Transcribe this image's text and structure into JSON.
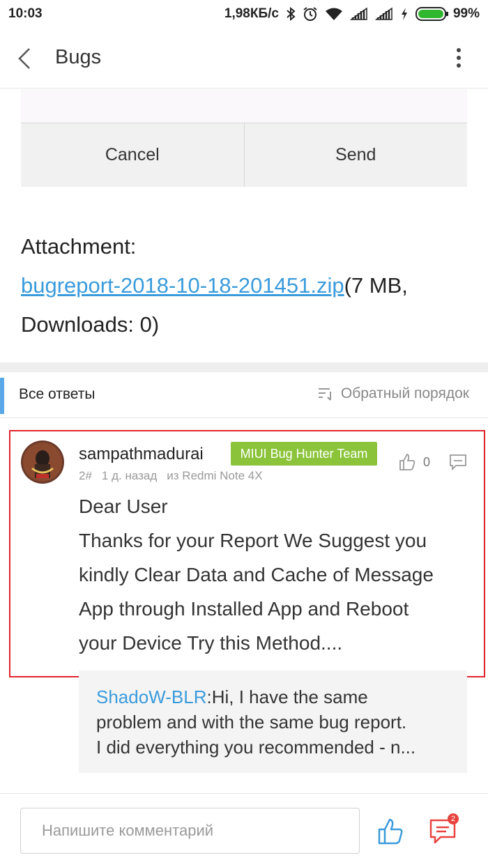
{
  "status_bar": {
    "time": "10:03",
    "speed": "1,98КБ/с",
    "battery": "99%"
  },
  "header": {
    "title": "Bugs"
  },
  "dialog": {
    "cancel_label": "Cancel",
    "send_label": "Send"
  },
  "attachment": {
    "label": "Attachment:",
    "file_link": "bugreport-2018-10-18-201451.zip",
    "size_info": "(7 MB,",
    "downloads": "Downloads: 0)"
  },
  "replies": {
    "title": "Все ответы",
    "order_label": "Обратный порядок"
  },
  "comment": {
    "username": "sampathmadurai",
    "badge": "MIUI Bug Hunter Team",
    "floor": "2#",
    "time": "1 д. назад",
    "device": "из Redmi Note 4X",
    "likes": "0",
    "body_lines": [
      "Dear User",
      "Thanks for your Report We Suggest you",
      "kindly Clear Data and Cache of Message",
      "App through Installed App and Reboot",
      "your Device Try this Method...."
    ]
  },
  "quote": {
    "author": "ShadoW-BLR",
    "lines": [
      ":Hi, I have the same",
      "problem and with the same bug report.",
      "I did everything you recommended - n..."
    ]
  },
  "bottom_bar": {
    "placeholder": "Напишите комментарий",
    "message_count": "2"
  },
  "colors": {
    "accent_blue": "#3a9bdc",
    "badge_green": "#8bc43a",
    "highlight_red": "#e0242c",
    "notification_red": "#e8433e"
  },
  "icons": [
    "back-arrow-icon",
    "more-vertical-icon",
    "sort-order-icon",
    "thumbs-up-icon",
    "reply-icon",
    "message-icon",
    "bluetooth-icon",
    "alarm-icon",
    "wifi-icon",
    "signal-icon",
    "charging-icon",
    "battery-icon"
  ]
}
